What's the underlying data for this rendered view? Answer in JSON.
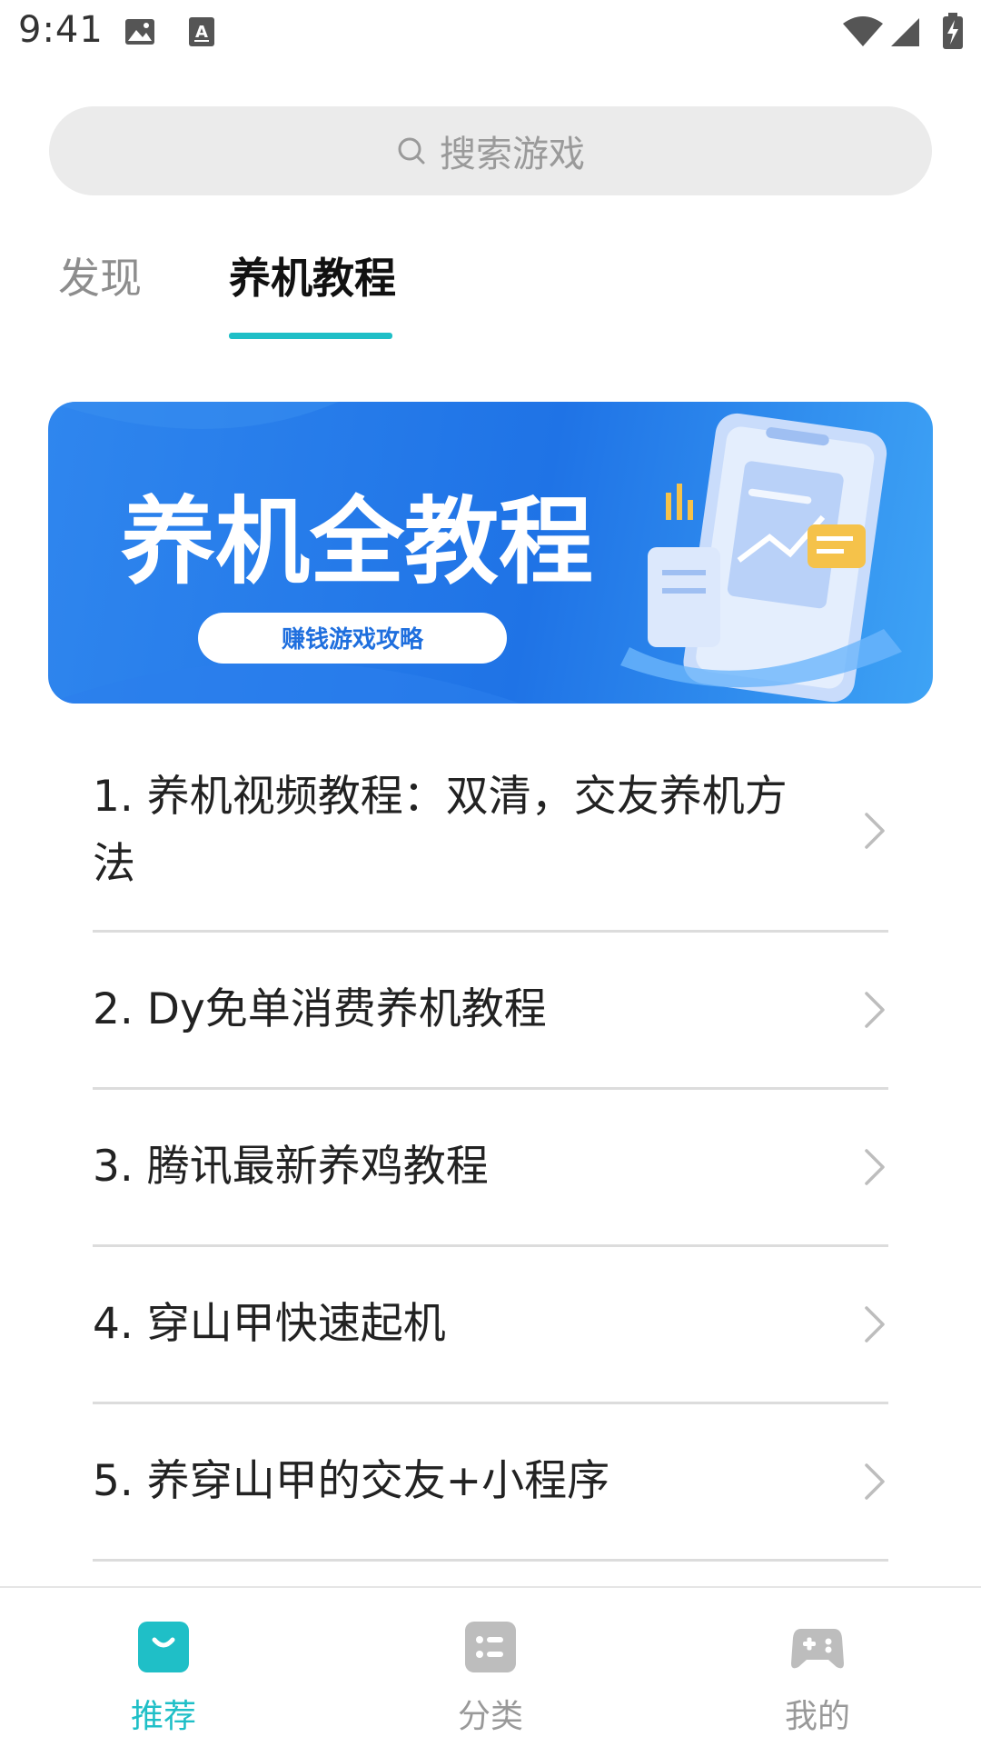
{
  "status_bar": {
    "time": "9:41",
    "icons": [
      "image-icon",
      "keyboard-a-icon",
      "wifi-icon",
      "signal-icon",
      "battery-charging-icon"
    ]
  },
  "search": {
    "placeholder": "搜索游戏",
    "icon": "search-icon"
  },
  "tabs": [
    {
      "label": "发现",
      "active": false
    },
    {
      "label": "养机教程",
      "active": true
    }
  ],
  "banner": {
    "title": "养机全教程",
    "subtitle": "赚钱游戏攻略"
  },
  "tutorials": [
    {
      "label": "1. 养机视频教程：双清，交友养机方法"
    },
    {
      "label": "2. Dy免单消费养机教程"
    },
    {
      "label": "3. 腾讯最新养鸡教程"
    },
    {
      "label": "4. 穿山甲快速起机"
    },
    {
      "label": "5. 养穿山甲的交友+小程序"
    }
  ],
  "bottom_nav": [
    {
      "label": "推荐",
      "icon": "shopping-bag-icon",
      "active": true
    },
    {
      "label": "分类",
      "icon": "category-list-icon",
      "active": false
    },
    {
      "label": "我的",
      "icon": "gamepad-icon",
      "active": false
    }
  ],
  "colors": {
    "accent": "#1fbfc7",
    "banner_blue": "#1f73e6",
    "divider": "#dcdcdc",
    "search_bg": "#ebebeb"
  }
}
